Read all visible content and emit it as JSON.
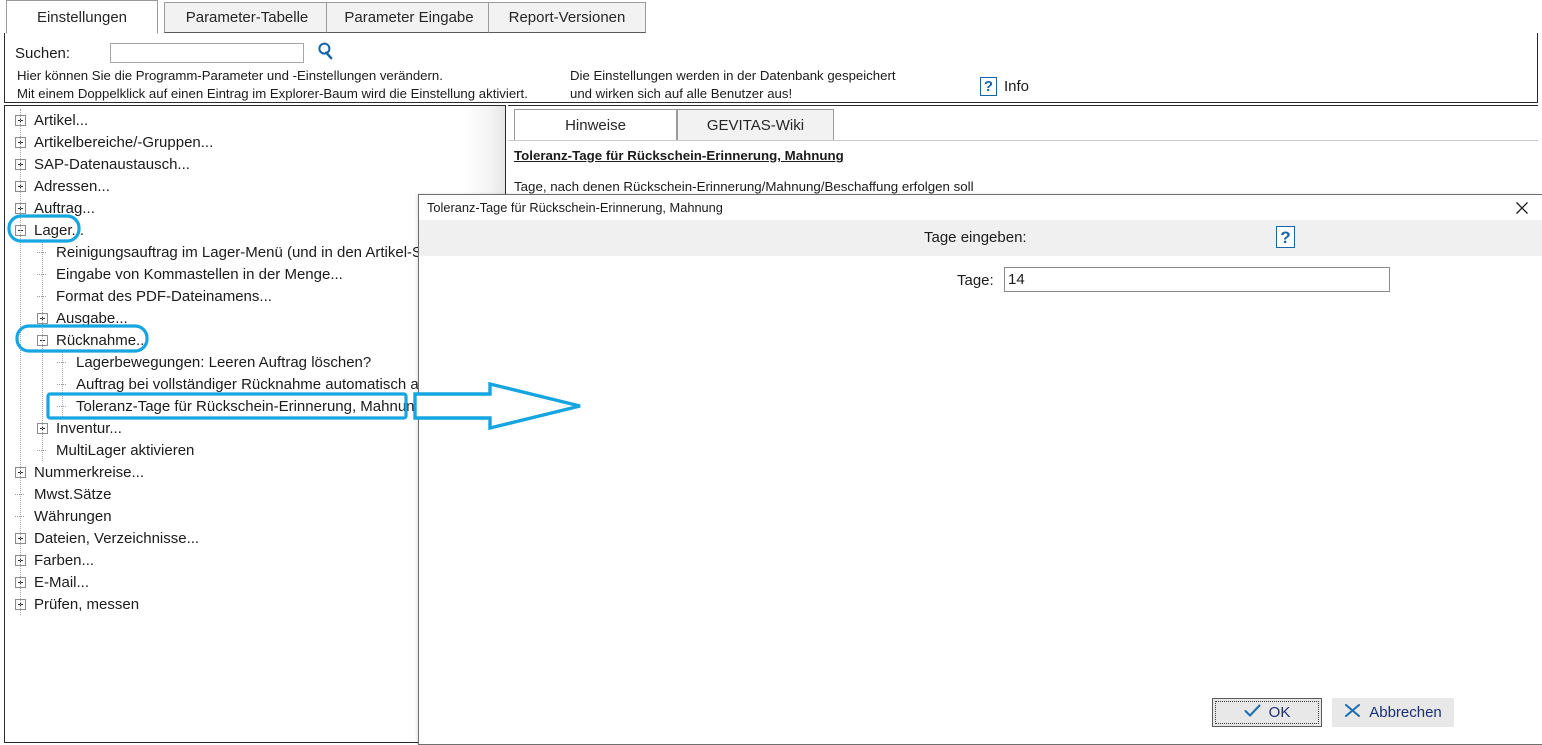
{
  "accent_color": "#15A5E0",
  "tabs": [
    {
      "label": "Einstellungen",
      "active": true
    },
    {
      "label": "Parameter-Tabelle",
      "active": false
    },
    {
      "label": "Parameter Eingabe",
      "active": false
    },
    {
      "label": "Report-Versionen",
      "active": false
    }
  ],
  "header": {
    "search_label": "Suchen:",
    "search_value": "",
    "search_placeholder": "",
    "search_icon": "magnifier-icon",
    "hint_left_line1": "Hier können Sie die Programm-Parameter und -Einstellungen verändern.",
    "hint_left_line2": "Mit einem Doppelklick auf einen Eintrag im Explorer-Baum wird die Einstellung  aktiviert.",
    "hint_right_line1": "Die Einstellungen werden in der Datenbank gespeichert",
    "hint_right_line2": "und wirken sich auf alle Benutzer aus!",
    "info_icon": "question-mark-icon",
    "info_label": "Info"
  },
  "tree": {
    "nodes": [
      {
        "label": "Artikel...",
        "depth": 0,
        "type": "plus"
      },
      {
        "label": "Artikelbereiche/-Gruppen...",
        "depth": 0,
        "type": "plus"
      },
      {
        "label": "SAP-Datenaustausch...",
        "depth": 0,
        "type": "plus"
      },
      {
        "label": "Adressen...",
        "depth": 0,
        "type": "plus"
      },
      {
        "label": "Auftrag...",
        "depth": 0,
        "type": "plus"
      },
      {
        "label": "Lager...",
        "depth": 0,
        "type": "minus",
        "highlight": "ellipse"
      },
      {
        "label": "Reinigungsauftrag im Lager-Menü  (und in den Artikel-Stammdaten)",
        "depth": 1,
        "type": "leaf"
      },
      {
        "label": "Eingabe von Kommastellen in der Menge...",
        "depth": 1,
        "type": "leaf"
      },
      {
        "label": "Format des PDF-Dateinamens...",
        "depth": 1,
        "type": "leaf"
      },
      {
        "label": "Ausgabe...",
        "depth": 1,
        "type": "plus"
      },
      {
        "label": "Rücknahme...",
        "depth": 1,
        "type": "minus",
        "highlight": "ellipse"
      },
      {
        "label": "Lagerbewegungen: Leeren Auftrag löschen?",
        "depth": 2,
        "type": "leaf"
      },
      {
        "label": "Auftrag bei vollständiger Rücknahme automatisch abschließen?",
        "depth": 2,
        "type": "leaf"
      },
      {
        "label": "Toleranz-Tage für Rückschein-Erinnerung, Mahnung",
        "depth": 2,
        "type": "leaf",
        "highlight": "rect"
      },
      {
        "label": "Inventur...",
        "depth": 1,
        "type": "plus"
      },
      {
        "label": "MultiLager aktivieren",
        "depth": 1,
        "type": "leaf"
      },
      {
        "label": "Nummerkreise...",
        "depth": 0,
        "type": "plus"
      },
      {
        "label": "Mwst.Sätze",
        "depth": 0,
        "type": "leaf"
      },
      {
        "label": "Währungen",
        "depth": 0,
        "type": "leaf"
      },
      {
        "label": "Dateien, Verzeichnisse...",
        "depth": 0,
        "type": "plus"
      },
      {
        "label": "Farben...",
        "depth": 0,
        "type": "plus"
      },
      {
        "label": "E-Mail...",
        "depth": 0,
        "type": "plus"
      },
      {
        "label": "Prüfen, messen",
        "depth": 0,
        "type": "plus"
      }
    ]
  },
  "hint_panel": {
    "tabs": [
      {
        "label": "Hinweise",
        "active": true
      },
      {
        "label": "GEVITAS-Wiki",
        "active": false
      }
    ],
    "title": "Toleranz-Tage für Rückschein-Erinnerung, Mahnung",
    "body": "Tage, nach denen Rückschein-Erinnerung/Mahnung/Beschaffung erfolgen soll"
  },
  "dialog": {
    "title": "Toleranz-Tage für Rückschein-Erinnerung, Mahnung",
    "close_icon": "close-icon",
    "band_title": "Tage eingeben:",
    "band_help_icon": "question-mark-icon",
    "field_label": "Tage:",
    "field_value": "14",
    "ok_label": "OK",
    "ok_icon": "checkmark-icon",
    "cancel_label": "Abbrechen",
    "cancel_icon": "x-icon"
  },
  "annotations": {
    "arrow": "callout-arrow",
    "color": "#15A5E0"
  }
}
